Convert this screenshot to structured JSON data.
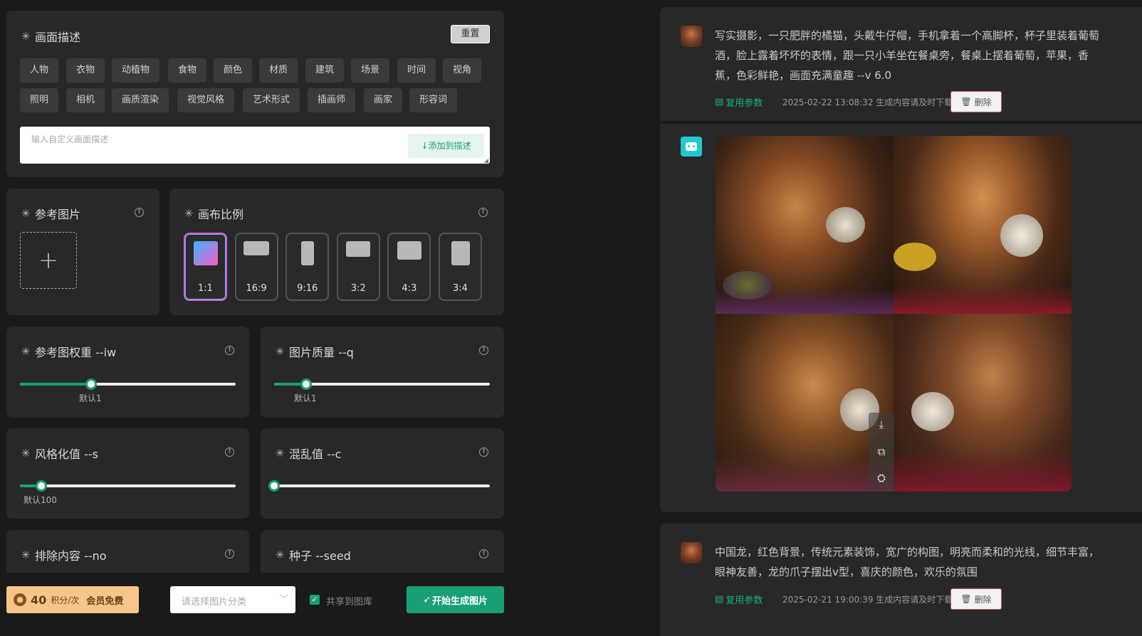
{
  "description_panel": {
    "title": "画面描述",
    "reset_label": "重置",
    "tags_row1": [
      "人物",
      "衣物",
      "动植物",
      "食物",
      "颜色",
      "材质",
      "建筑",
      "场景",
      "时间",
      "视角"
    ],
    "tags_row2": [
      "照明",
      "相机",
      "画质渲染",
      "视觉风格",
      "艺术形式",
      "插画师",
      "画家",
      "形容词"
    ],
    "custom_input_placeholder": "输入自定义画面描述",
    "add_button_label": "↓添加到描述"
  },
  "reference_image": {
    "title": "参考图片",
    "add_symbol": "+"
  },
  "canvas_ratio": {
    "title": "画布比例",
    "selected": "1:1",
    "options": [
      "1:1",
      "16:9",
      "9:16",
      "3:2",
      "4:3",
      "3:4"
    ]
  },
  "params": {
    "iw": {
      "title": "参考图权重 --iw",
      "hint": "默认1",
      "fraction": 0.33
    },
    "q": {
      "title": "图片质量 --q",
      "hint": "默认1",
      "fraction": 0.15
    },
    "s": {
      "title": "风格化值 --s",
      "hint": "默认100",
      "fraction": 0.1
    },
    "c": {
      "title": "混乱值 --c",
      "hint": "",
      "fraction": 0.0
    },
    "no": {
      "title": "排除内容 --no"
    },
    "seed": {
      "title": "种子 --seed"
    }
  },
  "footer": {
    "points_value": "40",
    "points_unit": "积分/次",
    "member_label": "会员免费",
    "category_placeholder": "请选择图片分类",
    "share_label": "共享到图库",
    "generate_label": "开始生成图片"
  },
  "history": [
    {
      "prompt": "写实摄影，一只肥胖的橘猫，头戴牛仔帽，手机拿着一个高脚杯，杯子里装着葡萄酒，脸上露着坏坏的表情，跟一只小羊坐在餐桌旁，餐桌上摆着葡萄，苹果，香蕉，色彩鲜艳，画面充满童趣 --v 6.0",
      "reuse_label": "复用参数",
      "meta": "2025-02-22 13:08:32 生成内容请及时下载",
      "delete_label": "删除"
    },
    {
      "prompt": "中国龙，红色背景，传统元素装饰，宽广的构图，明亮而柔和的光线，细节丰富，眼神友善，龙的爪子摆出v型，喜庆的颜色，欢乐的氛围",
      "reuse_label": "复用参数",
      "meta": "2025-02-21 19:00:39 生成内容请及时下载",
      "delete_label": "删除"
    }
  ],
  "icons": {
    "star": "asterisk-icon",
    "info": "info-icon",
    "download": "download-icon",
    "expand": "expand-icon",
    "variation": "variation-icon",
    "robot": "robot-icon",
    "trash": "trash-icon",
    "copy": "copy-icon",
    "coin": "coin-icon"
  },
  "colors": {
    "accent": "#19a077",
    "selected_gradient_start": "#38b6ff",
    "selected_gradient_end": "#ff5ac8"
  }
}
